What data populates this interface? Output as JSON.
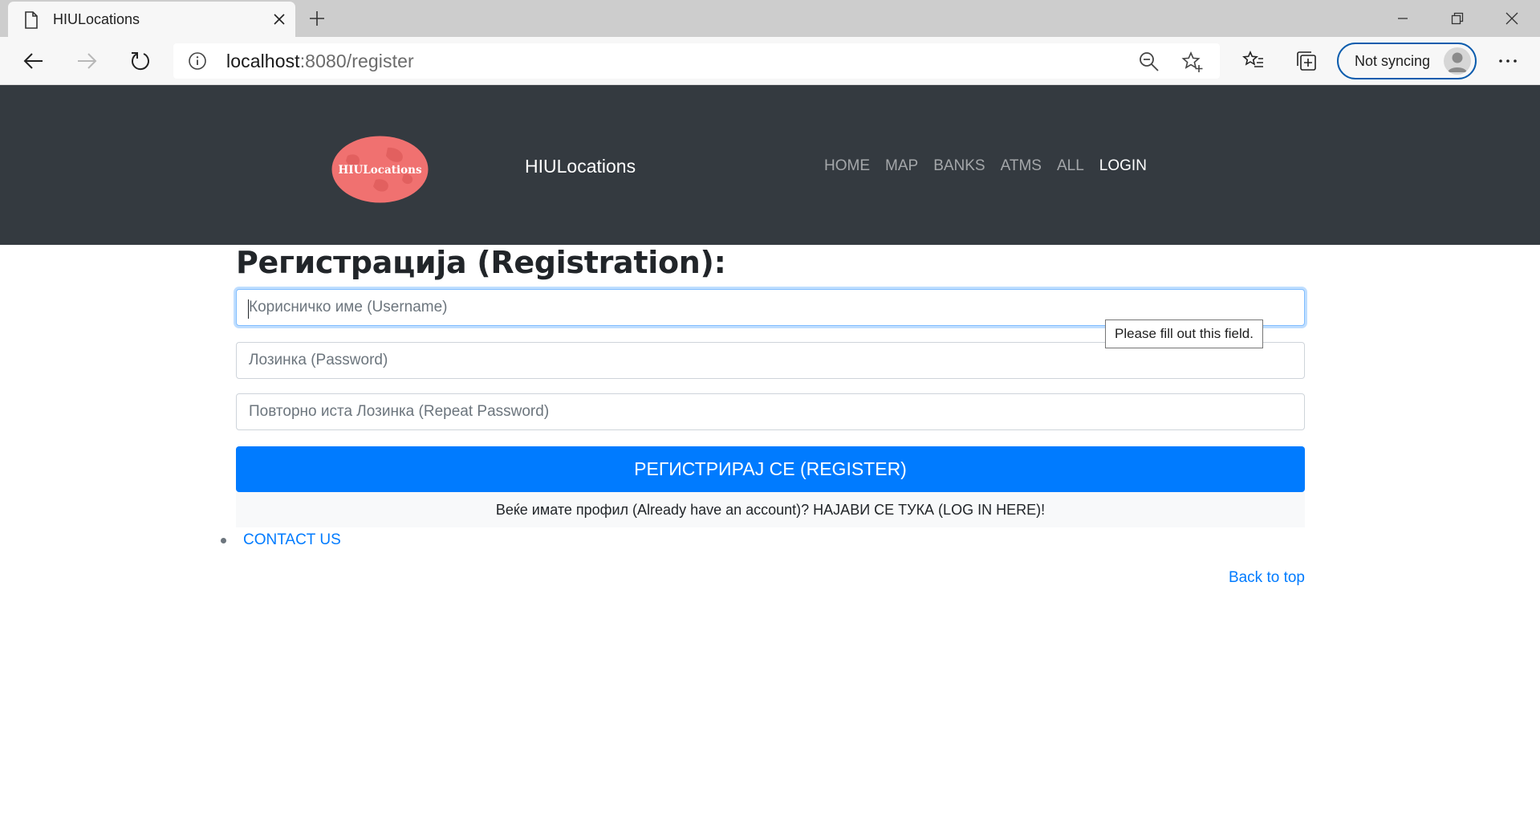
{
  "browser": {
    "tab_title": "HIULocations",
    "url_host": "localhost",
    "url_rest": ":8080/register",
    "sync_label": "Not syncing",
    "icons": {
      "page": "page-icon",
      "close": "close-icon",
      "new_tab": "plus-icon",
      "back": "back-arrow-icon",
      "forward": "forward-arrow-icon",
      "refresh": "refresh-icon",
      "info": "info-icon",
      "zoom": "zoom-out-icon",
      "favorite": "star-add-icon",
      "favorites": "favorites-list-icon",
      "collections": "collections-icon",
      "profile": "profile-avatar-icon",
      "more": "more-dots-icon"
    }
  },
  "header": {
    "logo_text": "HIULocations",
    "brand": "HIULocations",
    "nav": [
      "HOME",
      "MAP",
      "BANKS",
      "ATMS",
      "ALL",
      "LOGIN"
    ],
    "active_nav": "LOGIN"
  },
  "form": {
    "title": "Регистрација (Registration):",
    "username_placeholder": "Корисничко име (Username)",
    "username_value": "",
    "password_placeholder": "Лозинка (Password)",
    "password_value": "",
    "repeat_placeholder": "Повторно иста Лозинка (Repeat Password)",
    "repeat_value": "",
    "validation_tooltip": "Please fill out this field.",
    "submit_label": "РЕГИСТРИРАЈ СЕ (REGISTER)",
    "account_note": "Веќе имате профил (Already have an account)? НАЈАВИ СЕ ТУКА (LOG IN HERE)!"
  },
  "footer": {
    "contact_label": "CONTACT US",
    "back_to_top": "Back to top"
  },
  "colors": {
    "header_bg": "#343a40",
    "primary": "#007bff",
    "logo_fill": "#f07170"
  }
}
